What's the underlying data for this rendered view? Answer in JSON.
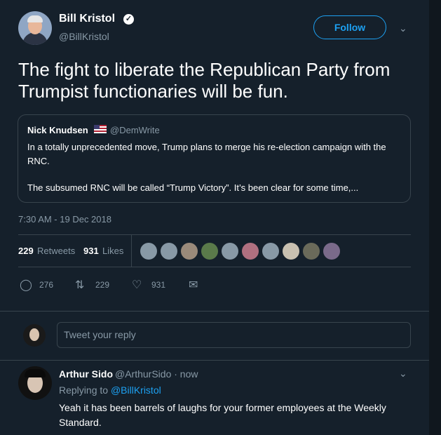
{
  "tweet": {
    "author_name": "Bill Kristol",
    "author_handle": "@BillKristol",
    "follow_label": "Follow",
    "text": "The fight to liberate the Republican Party from Trumpist functionaries will be fun.",
    "timestamp": "7:30 AM - 19 Dec 2018"
  },
  "quote": {
    "author_name": "Nick Knudsen",
    "author_handle": "@DemWrite",
    "text_line1": "In a totally unprecedented move, Trump plans to merge his re-election campaign with the RNC.",
    "text_line2": "The subsumed RNC will be called “Trump Victory”. It’s been clear for some time,..."
  },
  "stats": {
    "retweets_count": "229",
    "retweets_label": "Retweets",
    "likes_count": "931",
    "likes_label": "Likes"
  },
  "likers": [
    {
      "color": "#8899a6"
    },
    {
      "color": "#8899a6"
    },
    {
      "color": "#9a8a7a"
    },
    {
      "color": "#5a7a4a"
    },
    {
      "color": "#8899a6"
    },
    {
      "color": "#b07080"
    },
    {
      "color": "#8899a6"
    },
    {
      "color": "#c8c0b0"
    },
    {
      "color": "#6a6a5a"
    },
    {
      "color": "#7a6a8a"
    }
  ],
  "actions": {
    "reply_count": "276",
    "retweet_count": "229",
    "like_count": "931"
  },
  "reply_box": {
    "placeholder": "Tweet your reply"
  },
  "reply": {
    "author_name": "Arthur Sido",
    "author_handle_time": "@ArthurSido · now",
    "replying_prefix": "Replying to",
    "replying_to": "@BillKristol",
    "text": "Yeah it has been barrels of laughs for your former employees at the Weekly Standard."
  },
  "icons": {
    "verified": "verified-badge-icon",
    "chevron": "chevron-down-icon",
    "reply": "reply-icon",
    "retweet": "retweet-icon",
    "like": "heart-icon",
    "message": "direct-message-icon"
  },
  "colors": {
    "background": "#15202b",
    "accent": "#1da1f2",
    "muted": "#8899a6",
    "border": "#38444d"
  }
}
